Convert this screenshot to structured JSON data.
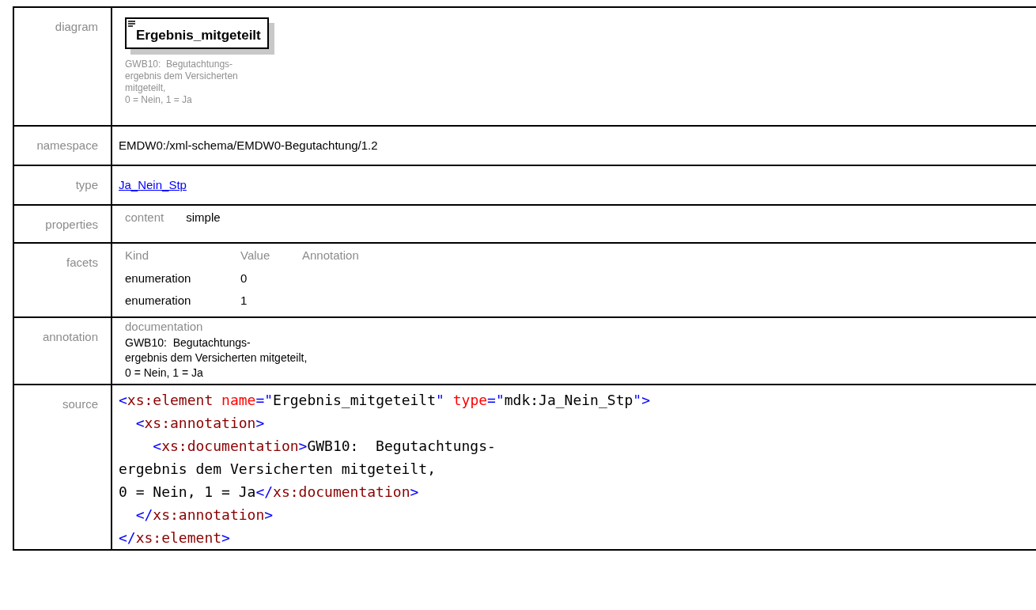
{
  "rows": [
    {
      "kind": "diagram",
      "label": "diagram",
      "element": "Ergebnis_mitgeteilt",
      "note_lines": [
        "GWB10:  Begutachtungs-",
        "ergebnis dem Versicherten",
        "mitgeteilt,",
        "0 = Nein, 1 = Ja"
      ]
    },
    {
      "kind": "text",
      "label": "namespace",
      "text": "EMDW0:/xml-schema/EMDW0-Begutachtung/1.2"
    },
    {
      "kind": "link",
      "label": "type",
      "text": "Ja_Nein_Stp"
    },
    {
      "kind": "properties",
      "label": "properties",
      "items": [
        {
          "name": "content",
          "value": "simple"
        }
      ]
    },
    {
      "kind": "facets",
      "label": "facets",
      "columns": [
        "Kind",
        "Value",
        "Annotation"
      ],
      "items": [
        [
          "enumeration",
          "0"
        ],
        [
          "enumeration",
          "1"
        ]
      ]
    },
    {
      "kind": "annotation",
      "label": "annotation",
      "heading": "documentation",
      "lines": [
        "GWB10:  Begutachtungs-",
        "ergebnis dem Versicherten mitgeteilt,",
        "0 = Nein, 1 = Ja"
      ]
    },
    {
      "kind": "source",
      "label": "source",
      "lines": [
        [
          {
            "kind": "bracket",
            "text": "<"
          },
          {
            "kind": "tag",
            "text": "xs:element "
          },
          {
            "kind": "attr",
            "text": "name"
          },
          {
            "kind": "bracket",
            "text": "=\""
          },
          {
            "kind": "value",
            "text": "Ergebnis_mitgeteilt"
          },
          {
            "kind": "bracket",
            "text": "\" "
          },
          {
            "kind": "attr",
            "text": "type"
          },
          {
            "kind": "bracket",
            "text": "=\""
          },
          {
            "kind": "value",
            "text": "mdk:Ja_Nein_Stp"
          },
          {
            "kind": "bracket",
            "text": "\">"
          }
        ],
        [
          {
            "kind": "bracket",
            "text": "  <"
          },
          {
            "kind": "tag",
            "text": "xs:annotation"
          },
          {
            "kind": "bracket",
            "text": ">"
          }
        ],
        [
          {
            "kind": "bracket",
            "text": "    <"
          },
          {
            "kind": "tag",
            "text": "xs:documentation"
          },
          {
            "kind": "bracket",
            "text": ">"
          },
          {
            "kind": "value",
            "text": "GWB10:  Begutachtungs-"
          }
        ],
        [
          {
            "kind": "value",
            "text": "ergebnis dem Versicherten mitgeteilt,"
          }
        ],
        [
          {
            "kind": "value",
            "text": "0 = Nein, 1 = Ja"
          },
          {
            "kind": "bracket",
            "text": "</"
          },
          {
            "kind": "tag",
            "text": "xs:documentation"
          },
          {
            "kind": "bracket",
            "text": ">"
          }
        ],
        [
          {
            "kind": "bracket",
            "text": "  </"
          },
          {
            "kind": "tag",
            "text": "xs:annotation"
          },
          {
            "kind": "bracket",
            "text": ">"
          }
        ],
        [
          {
            "kind": "bracket",
            "text": "</"
          },
          {
            "kind": "tag",
            "text": "xs:element"
          },
          {
            "kind": "bracket",
            "text": ">"
          }
        ]
      ]
    }
  ]
}
